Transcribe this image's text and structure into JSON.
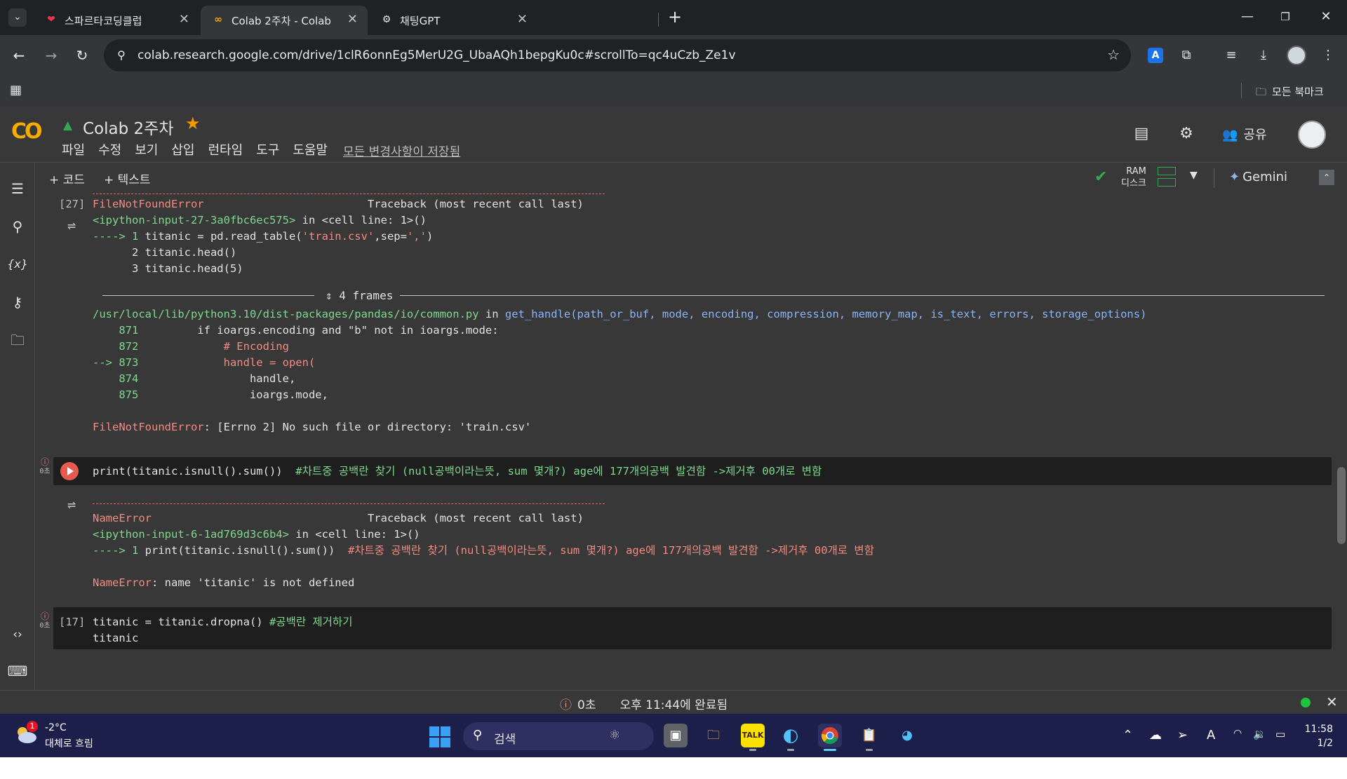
{
  "browser": {
    "tabs": [
      {
        "title": "스파르타코딩클럽",
        "close": "✕"
      },
      {
        "title": "Colab 2주차 - Colab",
        "close": "✕"
      },
      {
        "title": "채팅GPT",
        "close": "✕"
      }
    ],
    "new_tab": "+",
    "url": "colab.research.google.com/drive/1clR6onnEg5MerU2G_UbaAQh1bepgKu0c#scrollTo=qc4uCzb_Ze1v",
    "all_bookmarks": "모든 북마크",
    "extension_letter": "A"
  },
  "colab": {
    "logo": "CO",
    "notebook_title": "Colab 2주차",
    "menu": [
      "파일",
      "수정",
      "보기",
      "삽입",
      "런타임",
      "도구",
      "도움말"
    ],
    "save_status": "모든 변경사항이 저장됨",
    "share_label": "공유",
    "add_code": "+ 코드",
    "add_text": "+ 텍스트",
    "ram_label": "RAM",
    "disk_label": "디스크",
    "gemini_label": "Gemini"
  },
  "cells": {
    "cell1": {
      "exec_count": "[27]",
      "dashes": "---------------------------------------------------------------------------",
      "error_name": "FileNotFoundError",
      "traceback_header": "                         Traceback (most recent call last)",
      "input_ref": "<ipython-input-27-3a0fbc6ec575>",
      "in_cell": " in <cell line: 1>()",
      "arrow1": "----> 1 ",
      "line1_a": "titanic = pd.read_table(",
      "line1_str1": "'train.csv'",
      "line1_b": ",sep=",
      "line1_str2": "','",
      "line1_c": ")",
      "line2": "      2 titanic.head()",
      "line3": "      3 titanic.head(5)",
      "frames_label": "4 frames",
      "path": "/usr/local/lib/python3.10/dist-packages/pandas/io/common.py",
      "in_word": " in ",
      "func_sig": "get_handle(path_or_buf, mode, encoding, compression, memory_map, is_text, errors, storage_options)",
      "l871_no": "    871 ",
      "l871_code": "        if ioargs.encoding and \"b\" not in ioargs.mode:",
      "l872_no": "    872 ",
      "l872_code": "            # Encoding",
      "l873_no": "--> 873 ",
      "l873_code": "            handle = open(",
      "l874_no": "    874 ",
      "l874_code": "                handle,",
      "l875_no": "    875 ",
      "l875_code": "                ioargs.mode,",
      "final_error_name": "FileNotFoundError",
      "final_error_msg": ": [Errno 2] No such file or directory: 'train.csv'"
    },
    "cell2": {
      "status_time": "0초",
      "code": "print(titanic.isnull().sum())",
      "comment": "  #차트중 공백란 찾기 (null공백이라는뜻, sum 몇개?) age에 177개의공백 발견함 ->제거후 00개로 변함",
      "dashes": "---------------------------------------------------------------------------",
      "error_name": "NameError",
      "traceback_header": "                                 Traceback (most recent call last)",
      "input_ref": "<ipython-input-6-1ad769d3c6b4>",
      "in_cell": " in <cell line: 1>()",
      "arrow1": "----> 1 ",
      "line1": "print(titanic.isnull().sum())",
      "line1_comment": "  #차트중 공백란 찾기 (null공백이라는뜻, sum 몇개?) age에 177개의공백 발견함 ->제거후 00개로 변함",
      "final_error_name": "NameError",
      "final_error_msg": ": name 'titanic' is not defined"
    },
    "cell3": {
      "exec_count": "[17]",
      "status_time": "0초",
      "code": "titanic = titanic.dropna()",
      "comment": " #공백란 제거하기",
      "next_line": "titanic"
    }
  },
  "statusbar": {
    "time": "0초",
    "completed": "오후 11:44에 완료됨"
  },
  "taskbar": {
    "weather_badge": "1",
    "temperature": "-2°C",
    "weather_desc": "대체로 흐림",
    "search_label": "검색",
    "time": "11:58",
    "date": "1/2"
  },
  "colors": {
    "colab_orange": "#f9ab00",
    "error_red": "#f28b82",
    "status_green": "#1ec23e",
    "taskbar_bg": "#1c1f4a"
  }
}
